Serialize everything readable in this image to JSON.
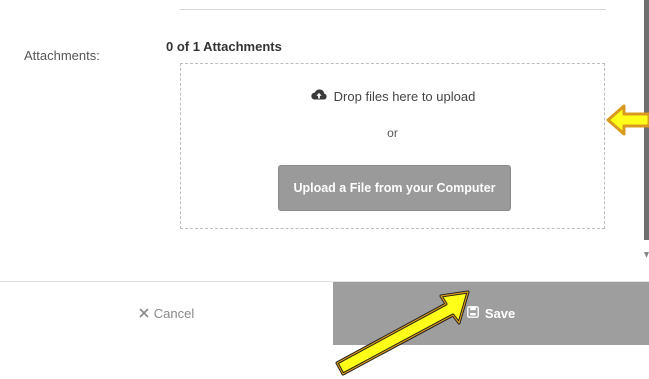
{
  "attachments": {
    "label": "Attachments:",
    "count_text": "0 of 1 Attachments",
    "drop_text": "Drop files here to upload",
    "or_text": "or",
    "upload_button_label": "Upload a File from your Computer"
  },
  "footer": {
    "cancel_label": "Cancel",
    "save_label": "Save"
  },
  "icons": {
    "upload": "cloud-upload-icon",
    "cancel": "close-icon",
    "save": "save-icon"
  },
  "colors": {
    "save_bg": "#9e9e9e",
    "upload_button_bg": "#9a9a9a",
    "annotation_arrow": "#ffff1a",
    "annotation_glow": "#d89a1e"
  }
}
